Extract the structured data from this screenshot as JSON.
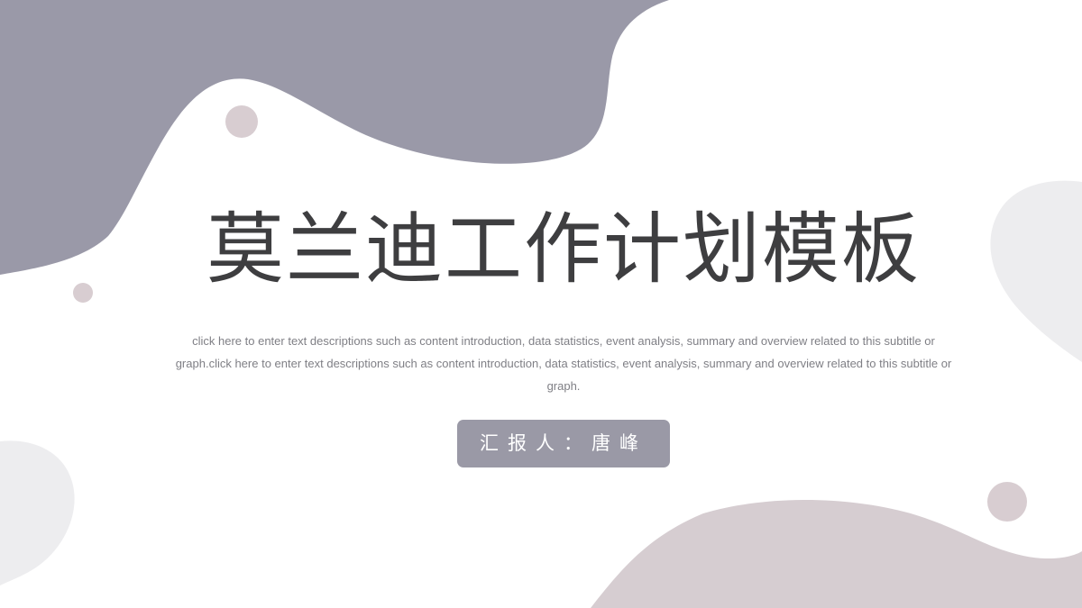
{
  "slide": {
    "title": "莫兰迪工作计划模板",
    "description": "click here to enter text descriptions such as content introduction, data statistics, event analysis, summary and overview related to this subtitle or graph.click here to enter text descriptions such as content introduction, data statistics, event analysis, summary and overview related to this subtitle or graph.",
    "reporter": "汇报人：唐峰"
  },
  "colors": {
    "top_blob": "#9a99a8",
    "bottom_blob": "#d6cdd1",
    "light_blob": "#ededef",
    "dot": "#d8cdd1",
    "title_text": "#3e3e40",
    "reporter_bg": "#9a99a6"
  }
}
